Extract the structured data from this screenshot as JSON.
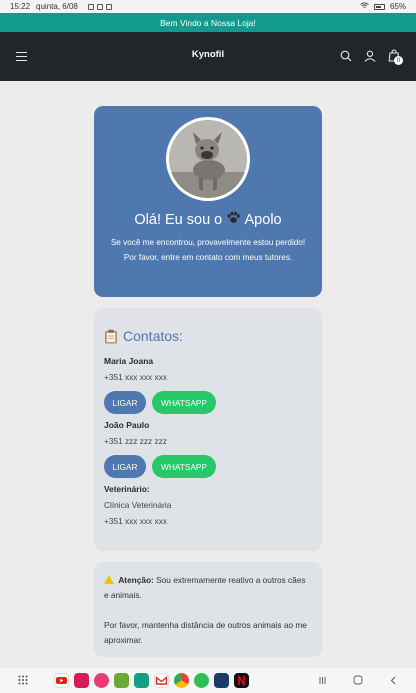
{
  "status_bar": {
    "time": "15:22",
    "date": "quinta, 6/08",
    "battery": "65%"
  },
  "announcement": "Bem Vindo a Nossa Loja!",
  "header": {
    "brand": "Kynofil",
    "cart_count": "0"
  },
  "profile": {
    "greeting": "Olá! Eu sou o",
    "pet_name": "Apolo",
    "line1": "Se você me encontrou, provavelmente estou perdido!",
    "line2": "Por favor, entre em contato com meus tutores."
  },
  "contacts": {
    "title": "Contatos:",
    "people": [
      {
        "name": "Maria Joana",
        "phone": "+351 xxx xxx xxx",
        "call_label": "LIGAR",
        "whatsapp_label": "WHATSAPP"
      },
      {
        "name": "João Paulo",
        "phone": "+351 zzz zzz zzz",
        "call_label": "LIGAR",
        "whatsapp_label": "WHATSAPP"
      }
    ],
    "vet": {
      "label": "Veterinário:",
      "clinic": "Clínica Veterinária",
      "phone": "+351 xxx xxx xxx"
    }
  },
  "attention": {
    "label": "Atenção:",
    "text1": "Sou extremamente reativo a outros cães e animais.",
    "text2": "Por favor, mantenha distância de outros animais ao me aproximar."
  },
  "colors": {
    "accent": "#4e78ae",
    "whatsapp": "#27c86a",
    "announce": "#129a8f",
    "header": "#21262b"
  }
}
